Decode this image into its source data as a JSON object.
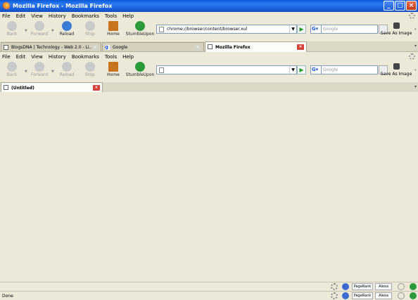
{
  "window": {
    "title": "Mozilla Firefox - Mozilla Firefox"
  },
  "menu": [
    "File",
    "Edit",
    "View",
    "History",
    "Bookmarks",
    "Tools",
    "Help"
  ],
  "toolbar": {
    "back": "Back",
    "forward": "Forward",
    "reload": "Reload",
    "stop": "Stop",
    "home": "Home",
    "stumble": "StumbleUpon",
    "save_as_image": "Save As Image",
    "search_placeholder": "Google"
  },
  "outer": {
    "url": "chrome://browser/content/browser.xul",
    "tabs": [
      {
        "label": "BlogsDNA | Technology - Web 2.0 - Li...",
        "active": false
      },
      {
        "label": "Google",
        "active": false
      },
      {
        "label": "Mozilla Firefox",
        "active": true
      }
    ]
  },
  "inner": {
    "url": "",
    "tabs": [
      {
        "label": "(Untitled)",
        "active": true
      }
    ]
  },
  "status": {
    "text": "Done",
    "pagerank": "PageRank",
    "alexa": "Alexa"
  },
  "colors": {
    "title_bar": "#0a58d9",
    "chrome": "#ece9d8",
    "tab_close_active": "#d6413a"
  }
}
